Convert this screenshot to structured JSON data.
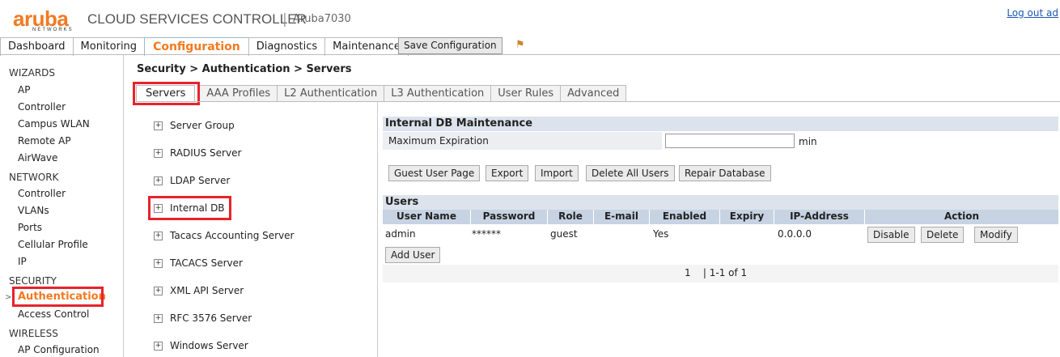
{
  "header": {
    "brand": "aruba",
    "brand_sub": "NETWORKS",
    "title": "CLOUD SERVICES CONTROLLER",
    "separator": "|",
    "hostname": "Aruba7030",
    "logout": "Log out ad"
  },
  "main_tabs": [
    "Dashboard",
    "Monitoring",
    "Configuration",
    "Diagnostics",
    "Maintenance"
  ],
  "save_button": "Save Configuration",
  "leftnav": {
    "wizards": "WIZARDS",
    "wizards_items": [
      "AP",
      "Controller",
      "Campus WLAN",
      "Remote AP",
      "AirWave"
    ],
    "network": "NETWORK",
    "network_items": [
      "Controller",
      "VLANs",
      "Ports",
      "Cellular Profile",
      "IP"
    ],
    "security": "SECURITY",
    "security_items": [
      "Authentication",
      "Access Control"
    ],
    "wireless": "WIRELESS",
    "wireless_items": [
      "AP Configuration"
    ]
  },
  "breadcrumb": "Security > Authentication > Servers",
  "sub_tabs": [
    "Servers",
    "AAA Profiles",
    "L2 Authentication",
    "L3 Authentication",
    "User Rules",
    "Advanced"
  ],
  "tree": [
    "Server Group",
    "RADIUS Server",
    "LDAP Server",
    "Internal DB",
    "Tacacs Accounting Server",
    "TACACS Server",
    "XML API Server",
    "RFC 3576 Server",
    "Windows Server"
  ],
  "internal_db": {
    "section_title": "Internal DB Maintenance",
    "max_expiration_label": "Maximum Expiration",
    "max_expiration_value": "",
    "unit": "min",
    "buttons": [
      "Guest User Page",
      "Export",
      "Import",
      "Delete All Users",
      "Repair Database"
    ]
  },
  "users": {
    "section_title": "Users",
    "columns": [
      "User Name",
      "Password",
      "Role",
      "E-mail",
      "Enabled",
      "Expiry",
      "IP-Address",
      "Action"
    ],
    "rows": [
      {
        "user": "admin",
        "password": "******",
        "role": "guest",
        "email": "",
        "enabled": "Yes",
        "expiry": "",
        "ip": "0.0.0.0"
      }
    ],
    "row_actions": [
      "Disable",
      "Delete",
      "Modify"
    ],
    "add_user": "Add User",
    "pager_page": "1",
    "pager_range": "| 1-1 of 1"
  }
}
